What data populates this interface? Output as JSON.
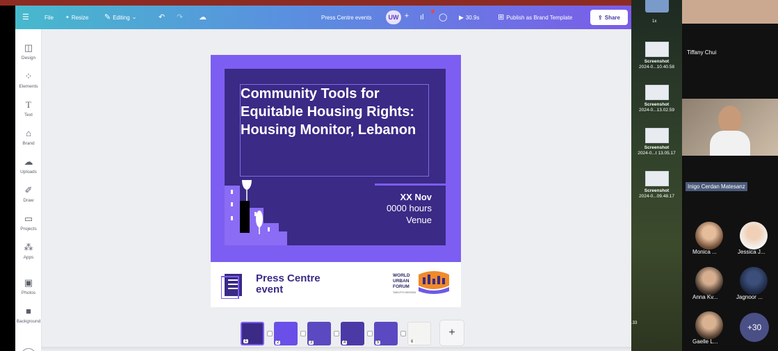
{
  "toolbar": {
    "menu_icon": "hamburger-icon",
    "file_label": "File",
    "resize_label": "Resize",
    "editing_label": "Editing",
    "design_name": "Press Centre events",
    "avatar_initials": "UW",
    "timer_label": "30.9s",
    "publish_label": "Publish as Brand Template",
    "share_label": "Share"
  },
  "sidebar": {
    "items": [
      {
        "label": "Design",
        "icon": "layout-icon"
      },
      {
        "label": "Elements",
        "icon": "shapes-icon"
      },
      {
        "label": "Text",
        "icon": "text-icon"
      },
      {
        "label": "Brand",
        "icon": "brand-icon"
      },
      {
        "label": "Uploads",
        "icon": "cloud-upload-icon"
      },
      {
        "label": "Draw",
        "icon": "pen-icon"
      },
      {
        "label": "Projects",
        "icon": "folder-icon"
      },
      {
        "label": "Apps",
        "icon": "apps-icon"
      },
      {
        "label": "Photos",
        "icon": "image-icon"
      },
      {
        "label": "Background",
        "icon": "background-icon"
      }
    ]
  },
  "design": {
    "title": "Community Tools for Equitable Housing Rights: Housing Monitor, Lebanon",
    "date": "XX Nov",
    "hours": "0000 hours",
    "venue": "Venue",
    "footer_label_line1": "Press Centre",
    "footer_label_line2": "event",
    "logo_line1": "WORLD",
    "logo_line2": "URBAN",
    "logo_line3": "FORUM",
    "logo_sub": "TWELFTH SESSION",
    "colors": {
      "page": "#7d5ef2",
      "panel": "#3b2a86",
      "footer": "#ffffff"
    }
  },
  "pages": {
    "numbers": [
      "1",
      "2",
      "3",
      "4",
      "5",
      "6"
    ],
    "add_label": "+"
  },
  "desktop": {
    "top_label": "1x",
    "files": [
      {
        "t1": "Screenshot",
        "t2": "2024-0...10.40.58"
      },
      {
        "t1": "Screenshot",
        "t2": "2024-0...13.02.59"
      },
      {
        "t1": "Screenshot",
        "t2": "2024-0...t 13.05.17"
      },
      {
        "t1": "Screenshot",
        "t2": "2024-0...09.48.17"
      }
    ],
    "clock_fragment": ".33"
  },
  "call": {
    "speaker1": "Tiffany Chui",
    "speaker2": "Inigo Cerdan Matesanz",
    "participants": [
      "Monica ...",
      "Jessica J...",
      "Anna Kv...",
      "Jagnoor ...",
      "Gaelle L..."
    ],
    "more_count": "+30"
  }
}
